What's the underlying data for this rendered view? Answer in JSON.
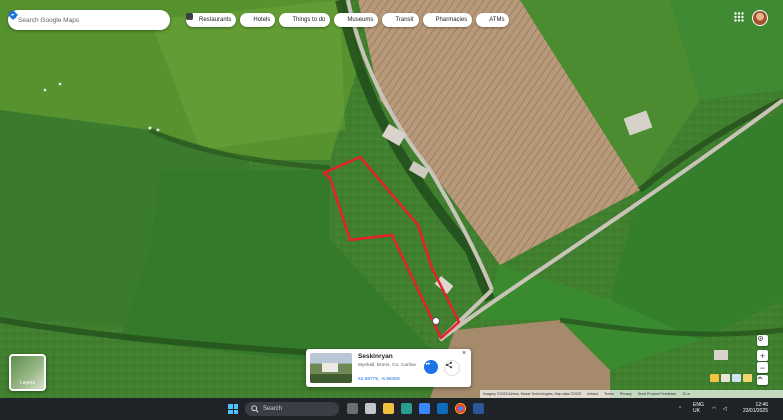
{
  "search": {
    "placeholder": "Search Google Maps"
  },
  "chips": [
    {
      "label": "Restaurants",
      "icon": "fork-knife-icon"
    },
    {
      "label": "Hotels",
      "icon": "bed-icon"
    },
    {
      "label": "Things to do",
      "icon": "camera-icon"
    },
    {
      "label": "Museums",
      "icon": "museum-icon"
    },
    {
      "label": "Transit",
      "icon": "bus-icon"
    },
    {
      "label": "Pharmacies",
      "icon": "pharmacy-icon"
    },
    {
      "label": "ATMs",
      "icon": "atm-icon"
    }
  ],
  "layers": {
    "label": "Layers"
  },
  "place": {
    "name": "Seskinryan",
    "address": "Myshall, Borris, Co. Carlow",
    "coords": "52.68775, -6.98468"
  },
  "controls": {
    "zoom_in": "+",
    "zoom_out": "−"
  },
  "attribution": {
    "imagery": "Imagery ©2025 Airbus, Maxar Technologies, Map data ©2025",
    "links": [
      "Ireland",
      "Terms",
      "Privacy",
      "Send Product Feedback"
    ],
    "scale": "20 m"
  },
  "taskbar": {
    "search_label": "Search",
    "tray_lang_1": "ENG",
    "tray_lang_2": "UK",
    "time": "12:46",
    "date": "23/01/2025"
  },
  "colors": {
    "boundary": "#e8202a",
    "accent": "#1a73e8",
    "taskbar": "#1f2328"
  }
}
